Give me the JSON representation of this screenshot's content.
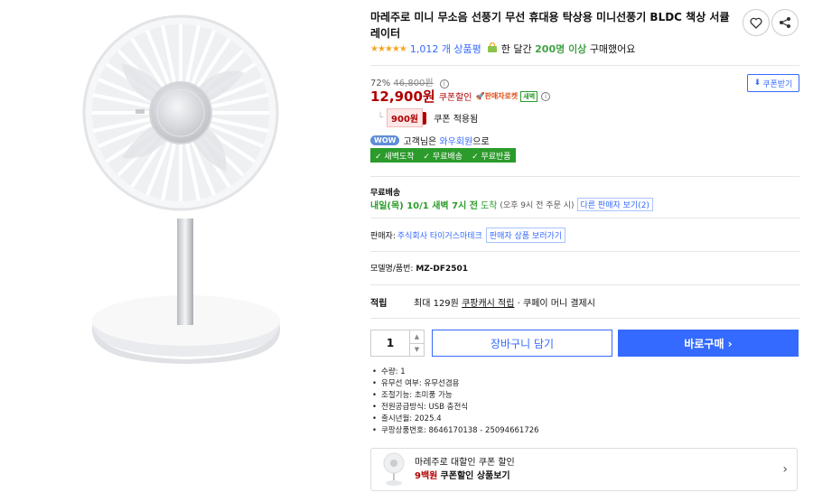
{
  "product": {
    "title": "마레주로 미니 무소음 선풍기 무선 휴대용 탁상용 미니선풍기 BLDC 책상 서큘레이터",
    "rating": {
      "stars": "★★★★★",
      "review_count": "1,012 개 상품평",
      "bought_prefix": "한 달간",
      "bought_highlight": "200명 이상",
      "bought_suffix": "구매했어요"
    },
    "price": {
      "discount_pct": "72%",
      "original": "46,800원",
      "sale": "12,900원",
      "coupon_label": "쿠폰할인",
      "seller_tag": "🚀판매자로켓",
      "dawn_tag": "새벽",
      "coupon_download": "쿠폰받기",
      "coupon_amount": "900원",
      "coupon_applied": "쿠폰 적용됨"
    },
    "wow": {
      "badge": "WOW",
      "text_prefix": "고객님은",
      "text_link": "와우회원",
      "text_suffix": "으로",
      "benefits": [
        "✓ 새벽도착",
        "✓ 무료배송",
        "✓ 무료반품"
      ]
    },
    "shipping": {
      "label": "무료배송",
      "arrival": "내일(목) 10/1 새벽 7시 전",
      "arrival_suffix": "도착",
      "note": "(오후 9시 전 주문 시)",
      "other_sellers": "다른 판매자 보기(2)"
    },
    "seller": {
      "label": "판매자:",
      "name": "주식회사 타이거스마테크",
      "products_btn": "판매자 상품 보러가기"
    },
    "model": {
      "label": "모델명/품번:",
      "value": "MZ-DF2501"
    },
    "reward": {
      "label": "적립",
      "prefix": "최대 129원",
      "link": "쿠팡캐시 적립",
      "suffix": "· 쿠페이 머니 결제시"
    },
    "order": {
      "quantity": "1",
      "cart_label": "장바구니 담기",
      "buy_label": "바로구매 ›"
    },
    "specs": [
      "수량: 1",
      "유무선 여부: 유무선겸용",
      "조절기능: 초미풍 가능",
      "전원공급방식: USB 충전식",
      "출시년월: 2025.4",
      "쿠팡상품번호: 8646170138 - 25094661726"
    ],
    "promo": {
      "line1": "마레주로 대할인 쿠폰 할인",
      "amount": "9백원",
      "line2": "쿠폰할인 상품보기"
    }
  },
  "colors": {
    "accent_blue": "#346aff",
    "price_red": "#ae0000",
    "green": "#2b9b2b"
  }
}
